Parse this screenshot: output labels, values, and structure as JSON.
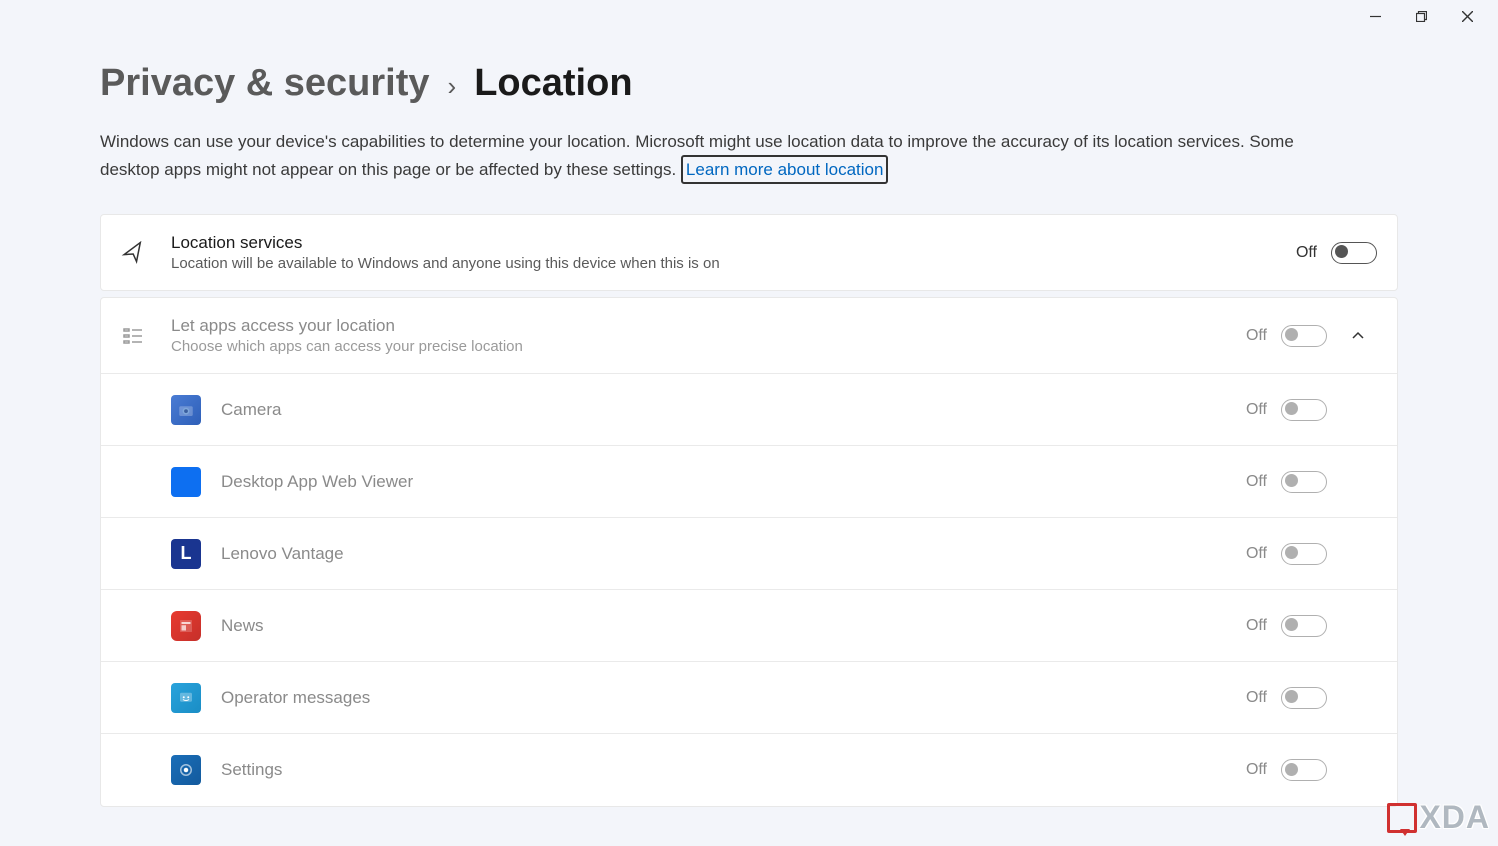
{
  "breadcrumb": {
    "parent": "Privacy & security",
    "current": "Location"
  },
  "description": "Windows can use your device's capabilities to determine your location. Microsoft might use location data to improve the accuracy of its location services. Some desktop apps might not appear on this page or be affected by these settings.",
  "learn_more": "Learn more about location",
  "location_services": {
    "title": "Location services",
    "subtitle": "Location will be available to Windows and anyone using this device when this is on",
    "state_label": "Off"
  },
  "apps_section": {
    "title": "Let apps access your location",
    "subtitle": "Choose which apps can access your precise location",
    "state_label": "Off"
  },
  "apps": [
    {
      "name": "Camera",
      "state_label": "Off",
      "icon": "camera"
    },
    {
      "name": "Desktop App Web Viewer",
      "state_label": "Off",
      "icon": "webviewer"
    },
    {
      "name": "Lenovo Vantage",
      "state_label": "Off",
      "icon": "lenovo"
    },
    {
      "name": "News",
      "state_label": "Off",
      "icon": "news"
    },
    {
      "name": "Operator messages",
      "state_label": "Off",
      "icon": "operator"
    },
    {
      "name": "Settings",
      "state_label": "Off",
      "icon": "settings"
    }
  ],
  "watermark": "XDA"
}
